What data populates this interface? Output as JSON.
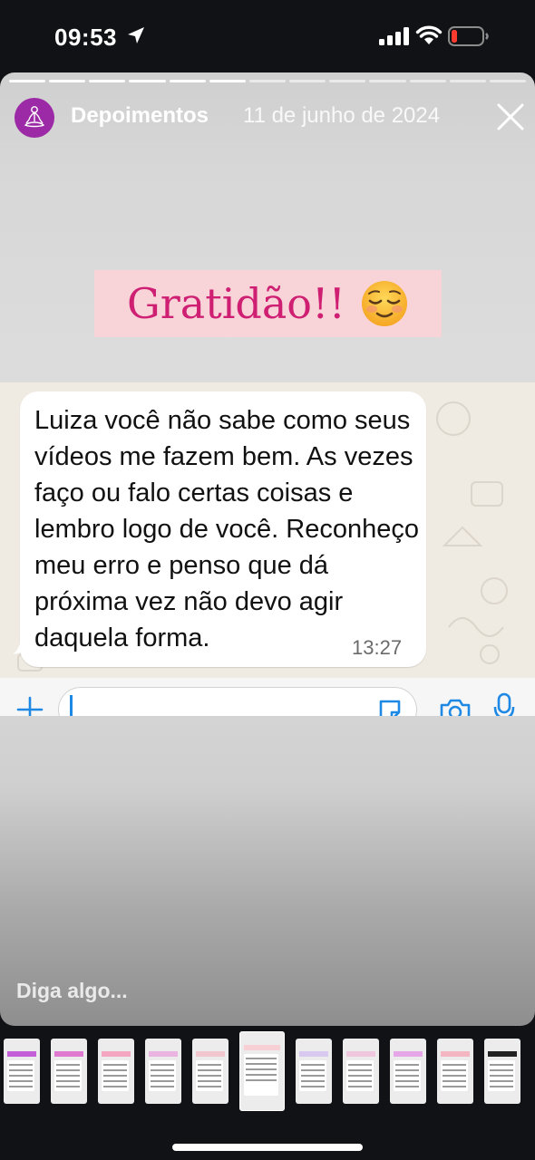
{
  "status_bar": {
    "time": "09:53"
  },
  "story": {
    "username": "Depoimentos",
    "date": "11 de junho de 2024",
    "progress_segments": 13,
    "current_segment": 6,
    "banner_text": "Gratidão!!",
    "banner_emoji": "relieved-face-emoji"
  },
  "chat": {
    "message": "Luiza você não sabe como seus vídeos me fazem bem. As vezes faço ou falo certas coisas e lembro logo de você. Reconheço meu erro e penso que dá próxima vez não devo agir daquela forma.",
    "time": "13:27"
  },
  "reply": {
    "placeholder": "Diga algo..."
  },
  "thumbnails": {
    "count": 11,
    "active_index": 5
  },
  "colors": {
    "banner_bg": "#f8d3d7",
    "banner_text": "#cf1f73",
    "avatar_bg": "#9c2aa6",
    "chat_bg": "#efeae2"
  }
}
